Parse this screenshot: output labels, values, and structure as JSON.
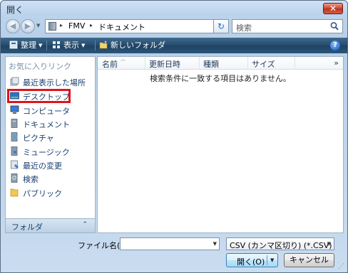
{
  "window": {
    "title": "開く",
    "close_label": "✕"
  },
  "address": {
    "segments": [
      "FMV",
      "ドキュメント"
    ],
    "separator": "▸"
  },
  "search": {
    "placeholder": "検索"
  },
  "toolbar": {
    "organize": "整理",
    "views": "表示",
    "new_folder": "新しいフォルダ"
  },
  "favorites": {
    "header": "お気に入りリンク",
    "items": [
      {
        "label": "最近表示した場所",
        "icon": "recent-places-icon"
      },
      {
        "label": "デスクトップ",
        "icon": "desktop-icon"
      },
      {
        "label": "コンピュータ",
        "icon": "computer-icon"
      },
      {
        "label": "ドキュメント",
        "icon": "documents-icon"
      },
      {
        "label": "ピクチャ",
        "icon": "pictures-icon"
      },
      {
        "label": "ミュージック",
        "icon": "music-icon"
      },
      {
        "label": "最近の変更",
        "icon": "recently-changed-icon"
      },
      {
        "label": "検索",
        "icon": "searches-icon"
      },
      {
        "label": "パブリック",
        "icon": "public-icon"
      }
    ],
    "folders_label": "フォルダ"
  },
  "columns": [
    "名前",
    "更新日時",
    "種類",
    "サイズ"
  ],
  "more_columns": "»",
  "empty_message": "検索条件に一致する項目はありません。",
  "filename": {
    "label": "ファイル名(N):",
    "value": ""
  },
  "filetype": {
    "selected": "CSV (カンマ区切り) (*.CSV)"
  },
  "buttons": {
    "open": "開く(O)",
    "cancel": "キャンセル"
  },
  "colors": {
    "highlight": "#e0141c",
    "toolbar": "#254a6b"
  }
}
